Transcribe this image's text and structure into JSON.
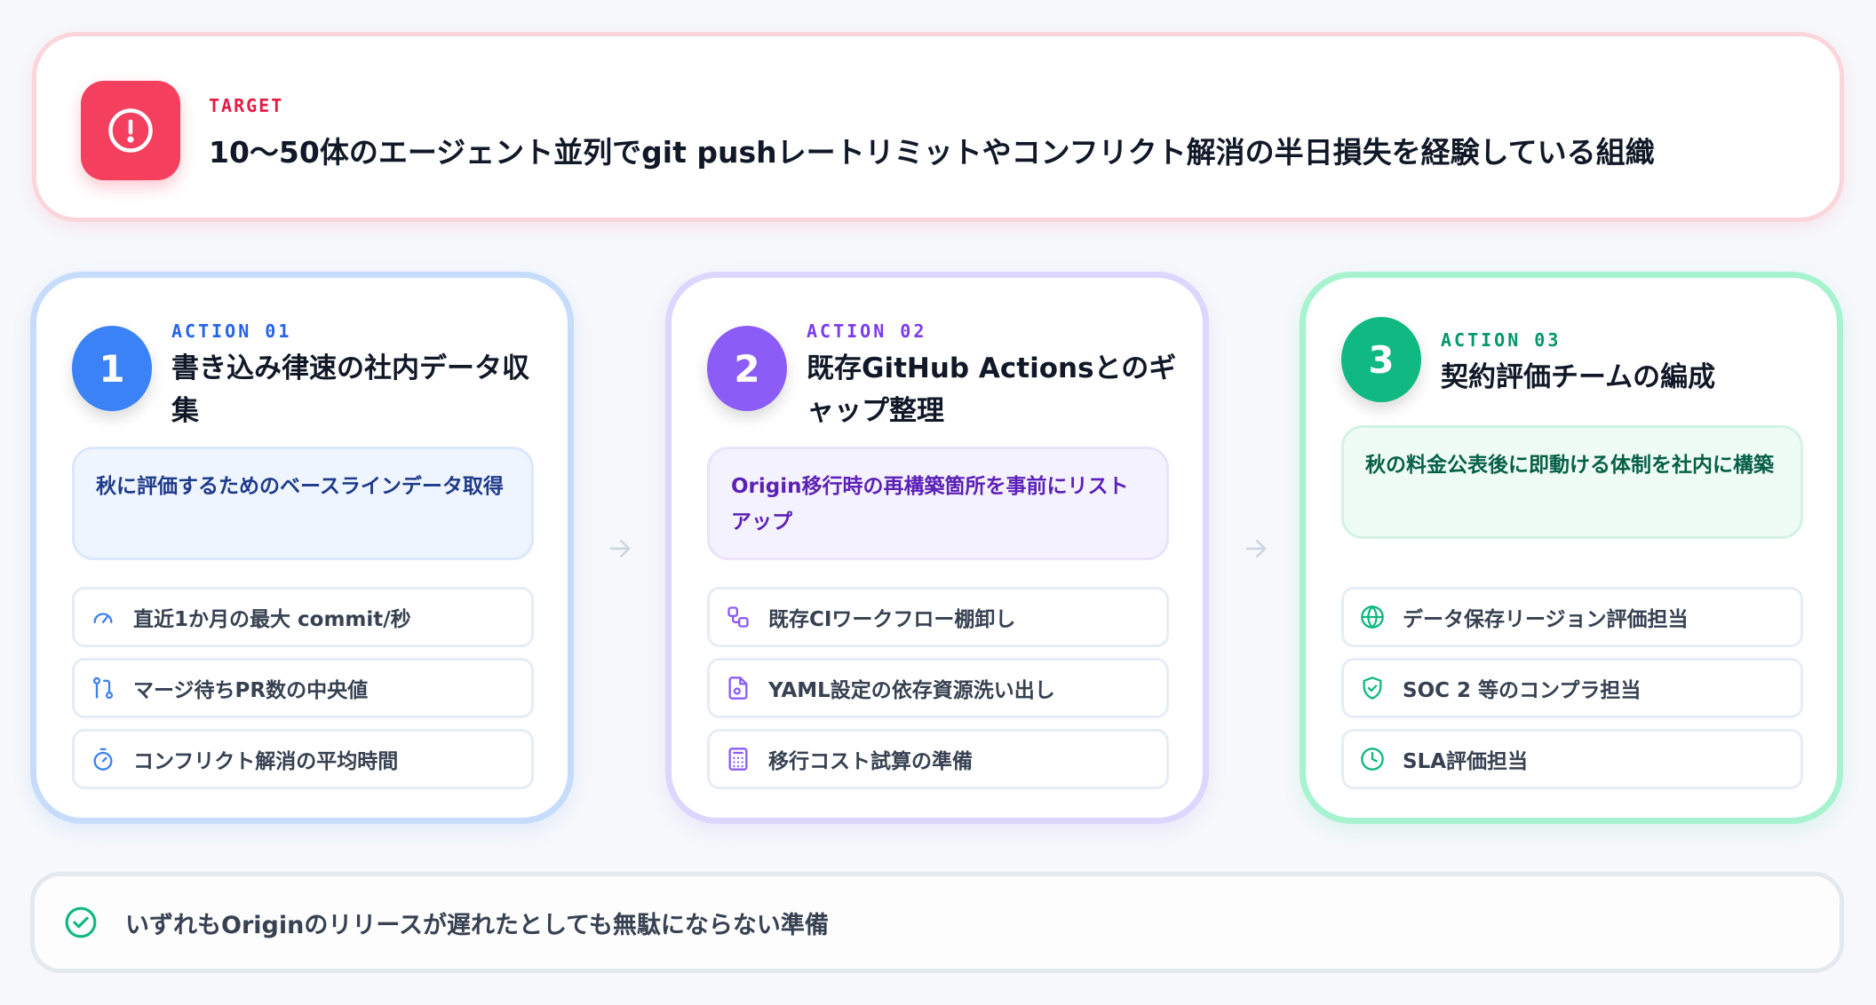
{
  "target": {
    "icon": "alert-icon",
    "kicker": "TARGET",
    "title": "10〜50体のエージェント並列でgit pushレートリミットやコンフリクト解消の半日損失を経験している組織",
    "accent": "#f43f5e"
  },
  "actions": [
    {
      "number": "1",
      "kicker": "ACTION 01",
      "title": "書き込み律速の社内データ収集",
      "goal": "秋に評価するためのベースラインデータ取得",
      "accent": "#3b82f6",
      "items": [
        {
          "icon": "gauge-icon",
          "label": "直近1か月の最大 commit/秒"
        },
        {
          "icon": "git-pull-request-icon",
          "label": "マージ待ちPR数の中央値"
        },
        {
          "icon": "stopwatch-icon",
          "label": "コンフリクト解消の平均時間"
        }
      ]
    },
    {
      "number": "2",
      "kicker": "ACTION 02",
      "title": "既存GitHub Actionsとのギャップ整理",
      "goal": "Origin移行時の再構築箇所を事前にリストアップ",
      "accent": "#8b5cf6",
      "items": [
        {
          "icon": "workflow-icon",
          "label": "既存CIワークフロー棚卸し"
        },
        {
          "icon": "file-cog-icon",
          "label": "YAML設定の依存資源洗い出し"
        },
        {
          "icon": "calculator-icon",
          "label": "移行コスト試算の準備"
        }
      ]
    },
    {
      "number": "3",
      "kicker": "ACTION 03",
      "title": "契約評価チームの編成",
      "goal": "秋の料金公表後に即動ける体制を社内に構築",
      "accent": "#10b981",
      "items": [
        {
          "icon": "globe-icon",
          "label": "データ保存リージョン評価担当"
        },
        {
          "icon": "shield-check-icon",
          "label": "SOC 2 等のコンプラ担当"
        },
        {
          "icon": "clock-icon",
          "label": "SLA評価担当"
        }
      ]
    }
  ],
  "footer": {
    "icon": "check-circle-icon",
    "text": "いずれもOriginのリリースが遅れたとしても無駄にならない準備",
    "accent": "#10b981"
  }
}
